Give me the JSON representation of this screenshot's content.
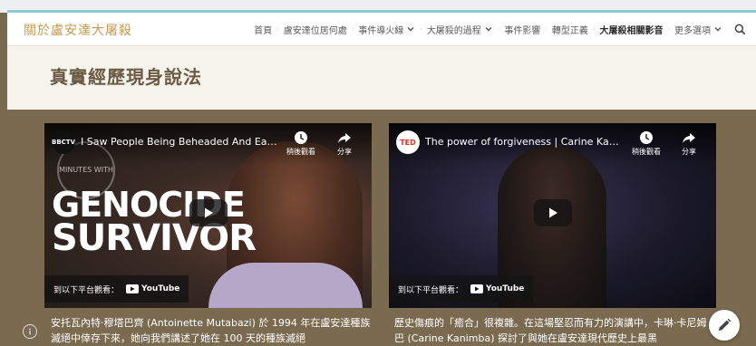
{
  "site": {
    "title": "關於盧安達大屠殺"
  },
  "nav": {
    "items": [
      {
        "label": "首頁"
      },
      {
        "label": "盧安達位居何處"
      },
      {
        "label": "事件導火線"
      },
      {
        "label": "大屠殺的過程"
      },
      {
        "label": "事件影響"
      },
      {
        "label": "轉型正義"
      },
      {
        "label": "大屠殺相關影音"
      },
      {
        "label": "更多選項"
      }
    ],
    "active": "大屠殺相關影音"
  },
  "page": {
    "title": "真實經歷現身說法"
  },
  "videos": [
    {
      "channel_badge": "BBCTV",
      "title": "I Saw People Being Beheaded And Eaten ...",
      "watch_later": "稍後觀看",
      "share": "分享",
      "watch_on": "到以下平台觀看：",
      "youtube": "YouTube",
      "thumb_line1": "GENOCIDE",
      "thumb_line2": "SURVIVOR",
      "thumb_small": "MINUTES WITH",
      "caption": "安托瓦內特·穆塔巴齊 (Antoinette Mutabazi) 於 1994 年在盧安達種族滅絕中倖存下來，她向我們講述了她在 100 天的種族滅絕"
    },
    {
      "channel_badge": "TED",
      "title": "The power of forgiveness | Carine Kanim...",
      "watch_later": "稍後觀看",
      "share": "分享",
      "watch_on": "到以下平台觀看：",
      "youtube": "YouTube",
      "caption": "歷史傷痕的「癒合」很複雜。在這場堅忍而有力的演講中，卡琳·卡尼姆巴 (Carine Kanimba) 探討了與她在盧安達現代歷史上最黑"
    }
  ],
  "colors": {
    "accent": "#c49a52",
    "content_bg": "#7a6a4f",
    "title_text": "#6b5a42"
  }
}
